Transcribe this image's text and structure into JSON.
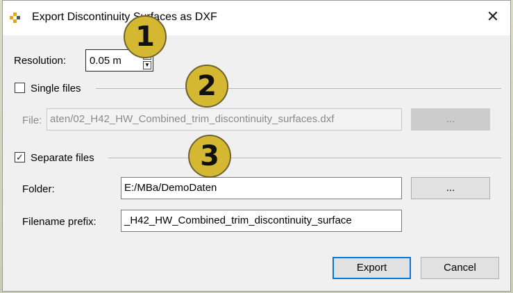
{
  "window": {
    "title": "Export Discontinuity Surfaces as DXF",
    "close_glyph": "✕"
  },
  "resolution": {
    "label": "Resolution:",
    "value": "0.05 m",
    "up_glyph": "▲",
    "down_glyph": "▼"
  },
  "single_files": {
    "label": "Single files",
    "checked_glyph": "",
    "file_label": "File:",
    "file_value": "aten/02_H42_HW_Combined_trim_discontinuity_surfaces.dxf",
    "browse_label": "..."
  },
  "separate_files": {
    "label": "Separate files",
    "checked_glyph": "✓",
    "folder_label": "Folder:",
    "folder_value": "E:/MBa/DemoDaten",
    "browse_label": "...",
    "prefix_label": "Filename prefix:",
    "prefix_value": "_H42_HW_Combined_trim_discontinuity_surface"
  },
  "buttons": {
    "export": "Export",
    "cancel": "Cancel"
  },
  "callouts": [
    "1",
    "2",
    "3"
  ],
  "colors": {
    "callout": "#d5b832",
    "accent": "#0078d7"
  }
}
